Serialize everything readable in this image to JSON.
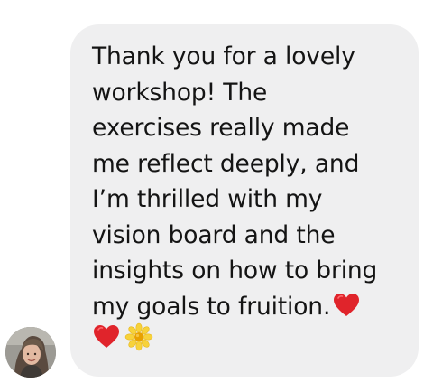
{
  "message": {
    "sender_avatar_alt": "Sender profile photo",
    "line_1": "Thank you for a lovely",
    "line_2": "workshop! The",
    "line_3": "exercises really made",
    "line_4": "me reflect deeply, and",
    "line_5": "I’m thrilled with my",
    "line_6": "vision board and the",
    "line_7": "insights on how to bring",
    "line_8": "my goals to fruition.",
    "emojis": [
      "red-heart-icon",
      "red-heart-icon",
      "daisy-icon"
    ]
  },
  "colors": {
    "bubble_background": "#efeff0",
    "text": "#141414",
    "heart": "#e0242b",
    "daisy_petals": "#f7d23a",
    "daisy_center": "#e8a100"
  }
}
